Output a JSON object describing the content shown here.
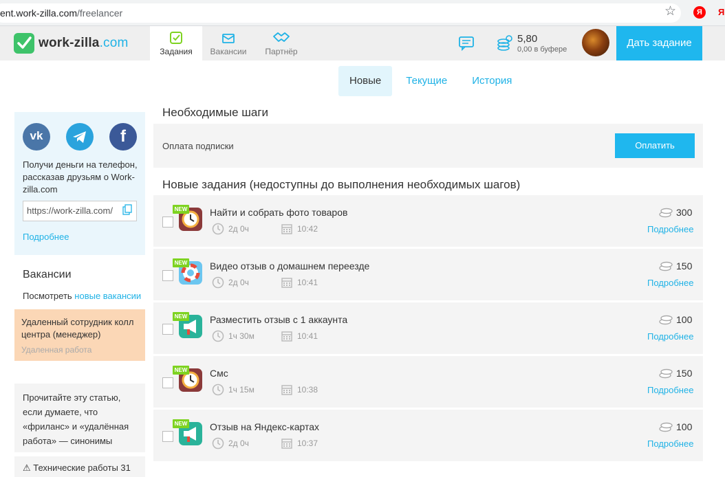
{
  "browser": {
    "url_host": "ent.work-zilla.com",
    "url_path": "/freelancer",
    "yandex_badge": "Я",
    "yandex_text": "Я"
  },
  "header": {
    "logo_main": "work-zilla",
    "logo_domain": ".com",
    "nav": [
      {
        "label": "Задания",
        "icon": "tasks-icon"
      },
      {
        "label": "Вакансии",
        "icon": "vacancies-icon"
      },
      {
        "label": "Партнёр",
        "icon": "partner-icon"
      }
    ],
    "balance_amount": "5,80",
    "balance_buffer": "0,00 в буфере",
    "give_task_label": "Дать задание"
  },
  "tabs": [
    "Новые",
    "Текущие",
    "История"
  ],
  "sidebar": {
    "social": [
      "vk-icon",
      "telegram-icon",
      "facebook-icon"
    ],
    "share_text": "Получи деньги на телефон, рассказав друзьям о Work-zilla.com",
    "ref_link": "https://work-zilla.com/",
    "more_label": "Подробнее",
    "vacancies_title": "Вакансии",
    "vacancies_look": "Посмотреть",
    "vacancies_link": "новые вакансии",
    "vacancy_card_title": "Удаленный сотрудник колл центра (менеджер)",
    "vacancy_card_sub": "Удаленная работа",
    "article_text": "Прочитайте эту статью, если думаете, что «фриланс» и «удалённая работа» — синонимы",
    "tech_notice": "⚠ Технические работы 31"
  },
  "main": {
    "steps_title": "Необходимые шаги",
    "steps_label": "Оплата подписки",
    "pay_label": "Оплатить",
    "tasks_title": "Новые задания (недоступны до выполнения необходимых шагов)",
    "badge_label": "NEW",
    "more_label": "Подробнее",
    "tasks": [
      {
        "name": "Найти и собрать фото товаров",
        "duration": "2д 0ч",
        "time": "10:42",
        "price": "300",
        "icon": "clock"
      },
      {
        "name": "Видео отзыв о домашнем переезде",
        "duration": "2д 0ч",
        "time": "10:41",
        "price": "150",
        "icon": "lifebuoy"
      },
      {
        "name": "Разместить отзыв с 1 аккаунта",
        "duration": "1ч 30м",
        "time": "10:41",
        "price": "100",
        "icon": "megaphone"
      },
      {
        "name": "Смс",
        "duration": "1ч 15м",
        "time": "10:38",
        "price": "150",
        "icon": "clock"
      },
      {
        "name": "Отзыв на Яндекс-картах",
        "duration": "2д 0ч",
        "time": "10:37",
        "price": "100",
        "icon": "megaphone"
      }
    ]
  },
  "colors": {
    "accent": "#1fb7ee",
    "logo_green": "#3ec36a",
    "badge_green": "#7ed321",
    "vacancy_bg": "#fbd7b6",
    "share_bg": "#eaf6fc"
  }
}
